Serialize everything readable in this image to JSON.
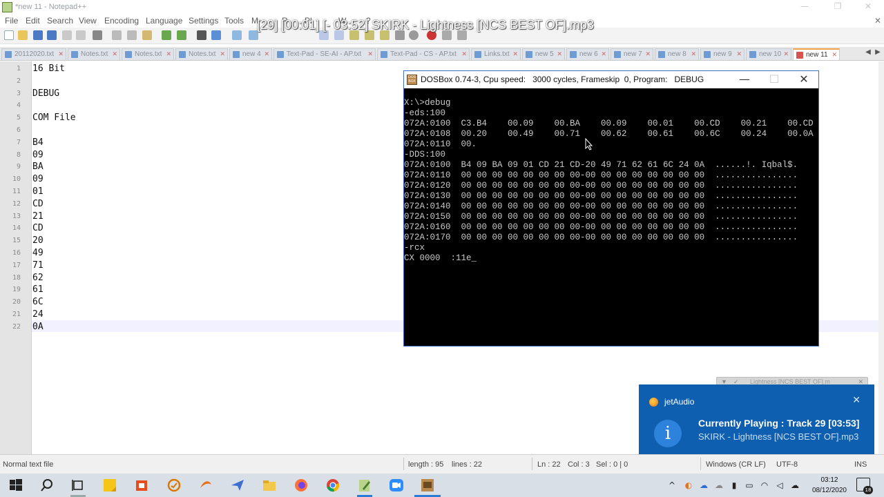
{
  "npp": {
    "window_title": "*new 11 - Notepad++",
    "menu": [
      "File",
      "Edit",
      "Search",
      "View",
      "Encoding",
      "Language",
      "Settings",
      "Tools",
      "M",
      "R",
      "Pl",
      "W",
      "?"
    ],
    "tabs": [
      "20112020.txt",
      "Notes.txt",
      "Notes.txt",
      "Notes.txt",
      "new 4",
      "Text-Pad - SE-AI - AP.txt",
      "Text-Pad - CS - AP.txt",
      "Links.txt",
      "new 5",
      "new 6",
      "new 7",
      "new 8",
      "new 9",
      "new 10",
      "new 11"
    ],
    "active_tab": "new 11",
    "lines": [
      {
        "n": "1",
        "text": "16 Bit"
      },
      {
        "n": "2",
        "text": ""
      },
      {
        "n": "3",
        "text": "DEBUG"
      },
      {
        "n": "4",
        "text": ""
      },
      {
        "n": "5",
        "text": "COM File"
      },
      {
        "n": "6",
        "text": ""
      },
      {
        "n": "7",
        "text": "B4"
      },
      {
        "n": "8",
        "text": "09"
      },
      {
        "n": "9",
        "text": "BA"
      },
      {
        "n": "10",
        "text": "09"
      },
      {
        "n": "11",
        "text": "01"
      },
      {
        "n": "12",
        "text": "CD"
      },
      {
        "n": "13",
        "text": "21"
      },
      {
        "n": "14",
        "text": "CD"
      },
      {
        "n": "15",
        "text": "20"
      },
      {
        "n": "16",
        "text": "49"
      },
      {
        "n": "17",
        "text": "71"
      },
      {
        "n": "18",
        "text": "62"
      },
      {
        "n": "19",
        "text": "61"
      },
      {
        "n": "20",
        "text": "6C"
      },
      {
        "n": "21",
        "text": "24"
      },
      {
        "n": "22",
        "text": "0A"
      }
    ],
    "status": {
      "file_type": "Normal text file",
      "length": "length : 95",
      "lines": "lines : 22",
      "ln": "Ln : 22",
      "col": "Col : 3",
      "sel": "Sel : 0 | 0",
      "eol": "Windows (CR LF)",
      "encoding": "UTF-8",
      "mode": "INS"
    }
  },
  "track_banner": "[29] [00:01] [- 03:52] SKIRK - Lightness [NCS BEST OF].mp3",
  "dosbox": {
    "title": "DOSBox 0.74-3, Cpu speed:   3000 cycles, Frameskip  0, Program:   DEBUG",
    "minimize": "—",
    "maximize": "☐",
    "close": "✕",
    "lines": [
      "X:\\>debug",
      "-eds:100",
      "072A:0100  C3.B4    00.09    00.BA    00.09    00.01    00.CD    00.21    00.CD",
      "072A:0108  00.20    00.49    00.71    00.62    00.61    00.6C    00.24    00.0A",
      "072A:0110  00.",
      "-DDS:100",
      "072A:0100  B4 09 BA 09 01 CD 21 CD-20 49 71 62 61 6C 24 0A  ......!. Iqbal$.",
      "072A:0110  00 00 00 00 00 00 00 00-00 00 00 00 00 00 00 00  ................",
      "072A:0120  00 00 00 00 00 00 00 00-00 00 00 00 00 00 00 00  ................",
      "072A:0130  00 00 00 00 00 00 00 00-00 00 00 00 00 00 00 00  ................",
      "072A:0140  00 00 00 00 00 00 00 00-00 00 00 00 00 00 00 00  ................",
      "072A:0150  00 00 00 00 00 00 00 00-00 00 00 00 00 00 00 00  ................",
      "072A:0160  00 00 00 00 00 00 00 00-00 00 00 00 00 00 00 00  ................",
      "072A:0170  00 00 00 00 00 00 00 00-00 00 00 00 00 00 00 00  ................",
      "-rcx",
      "CX 0000  :11e_"
    ]
  },
  "mini_player": "Lightness [NCS BEST OF].m",
  "jetaudio": {
    "app": "jetAudio",
    "close": "✕",
    "info_glyph": "i",
    "headline": "Currently Playing : Track 29 [03:53]",
    "subtitle": "SKIRK - Lightness [NCS BEST OF].mp3"
  },
  "taskbar": {
    "time": "03:12",
    "date": "08/12/2020",
    "notifications": "18"
  },
  "colors": {
    "accent": "#2c7bd6",
    "jet_bg": "#0f5fb0",
    "dos_fg": "#c8c8c8"
  }
}
